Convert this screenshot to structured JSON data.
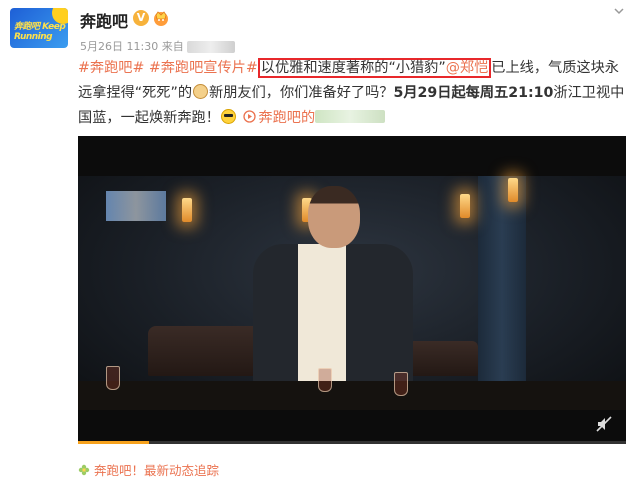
{
  "post": {
    "author_name": "奔跑吧",
    "author_verified_badge": "V",
    "avatar_logo": "奔跑吧 Keep Running",
    "meta_date": "5月26日 11:30",
    "meta_source_prefix": "来自",
    "content": {
      "tag1": "#奔跑吧#",
      "tag2": "#奔跑吧宣传片#",
      "highlight_text": "以优雅和速度著称的“小猎豹”",
      "mention": "@郑恺",
      "text_after_mention": "已上线，气质这块永远拿捏得“死死”的",
      "text_after_emoji1": "新朋友们，你们准备好了吗？",
      "bold_text": "5月29日起每周五21:10",
      "text_line3": "浙江卫视中国蓝，一起焕新奔跑！",
      "link_text": "奔跑吧的"
    },
    "video": {
      "progress_fraction": 0.13
    },
    "feed_link": "奔跑吧！最新动态追踪"
  },
  "icons": {
    "verified": "v-verified-icon",
    "vip": "vip-crown-icon",
    "more": "chevron-down-icon",
    "link": "video-link-icon",
    "mute": "mute-icon",
    "feed": "flower-icon"
  },
  "colors": {
    "accent": "#eb7350",
    "highlight_border": "#e8282b",
    "progress": "#f7a21d"
  }
}
